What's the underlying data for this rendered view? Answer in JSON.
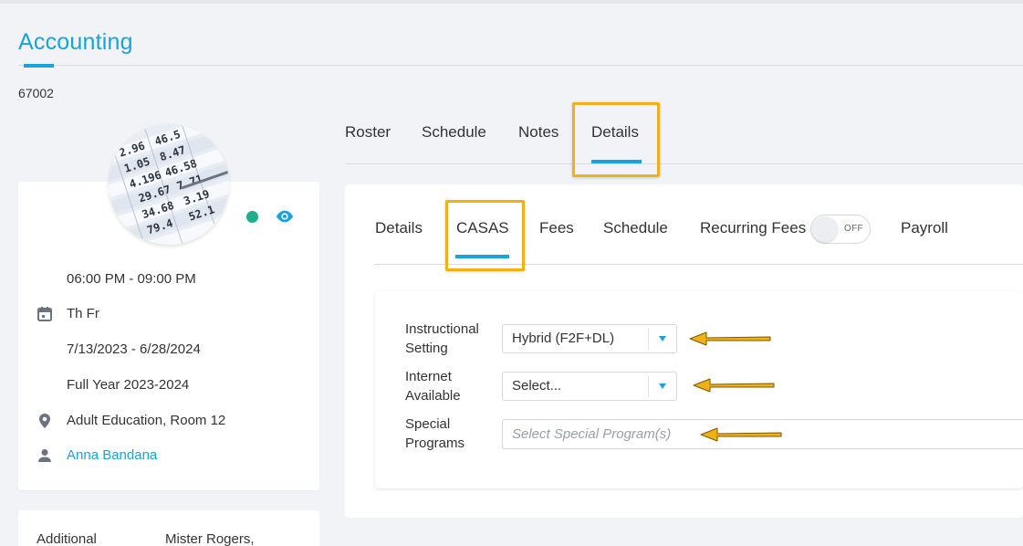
{
  "page": {
    "title": "Accounting",
    "course_code": "67002"
  },
  "course_info": {
    "time": "06:00 PM - 09:00 PM",
    "days": "Th Fr",
    "date_range": "7/13/2023 - 6/28/2024",
    "term": "Full Year 2023-2024",
    "location": "Adult Education, Room 12",
    "instructor": "Anna Bandana",
    "status_color": "#1fae8c"
  },
  "additional": {
    "label": "Additional",
    "value": "Mister Rogers,"
  },
  "top_tabs": [
    {
      "label": "Roster"
    },
    {
      "label": "Schedule"
    },
    {
      "label": "Notes"
    },
    {
      "label": "Details",
      "active": true
    }
  ],
  "sub_tabs": [
    {
      "label": "Details"
    },
    {
      "label": "CASAS",
      "active": true
    },
    {
      "label": "Fees"
    },
    {
      "label": "Schedule"
    },
    {
      "label": "Recurring Fees"
    },
    {
      "label": "Payroll"
    }
  ],
  "recurring_toggle": {
    "label": "OFF",
    "on": false
  },
  "form": {
    "instructional_setting": {
      "label_line1": "Instructional",
      "label_line2": "Setting",
      "value": "Hybrid (F2F+DL)"
    },
    "internet_available": {
      "label_line1": "Internet",
      "label_line2": "Available",
      "value": "Select..."
    },
    "special_programs": {
      "label_line1": "Special",
      "label_line2": "Programs",
      "placeholder": "Select Special Program(s)"
    }
  },
  "colors": {
    "accent": "#1aa3d9",
    "highlight": "#f0b116",
    "arrow": "#f0b116"
  },
  "icons": {
    "eye": "eye-icon",
    "calendar": "calendar-icon",
    "location": "location-pin-icon",
    "person": "person-icon",
    "caret": "chevron-down-icon",
    "arrow": "arrow-left-icon"
  }
}
